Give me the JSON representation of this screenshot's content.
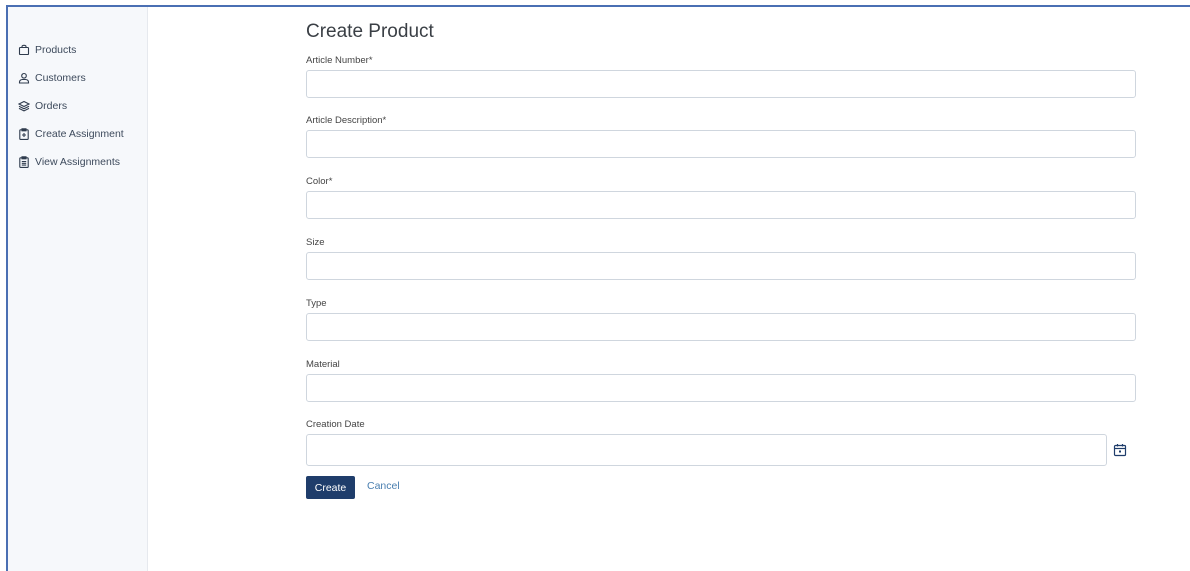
{
  "sidebar": {
    "items": [
      {
        "label": "Products",
        "icon": "bag-icon"
      },
      {
        "label": "Customers",
        "icon": "user-icon"
      },
      {
        "label": "Orders",
        "icon": "layers-icon"
      },
      {
        "label": "Create Assignment",
        "icon": "clipboard-plus-icon"
      },
      {
        "label": "View Assignments",
        "icon": "clipboard-list-icon"
      }
    ]
  },
  "form": {
    "title": "Create Product",
    "fields": [
      {
        "label": "Article Number*",
        "value": ""
      },
      {
        "label": "Article Description*",
        "value": ""
      },
      {
        "label": "Color*",
        "value": ""
      },
      {
        "label": "Size",
        "value": ""
      },
      {
        "label": "Type",
        "value": ""
      },
      {
        "label": "Material",
        "value": ""
      },
      {
        "label": "Creation Date",
        "value": ""
      }
    ],
    "create_label": "Create",
    "cancel_label": "Cancel"
  },
  "colors": {
    "accent": "#1f3d6b",
    "link": "#4a7fb0",
    "sidebar_bg": "#f6f8fb",
    "frame": "#4a6fb3"
  }
}
